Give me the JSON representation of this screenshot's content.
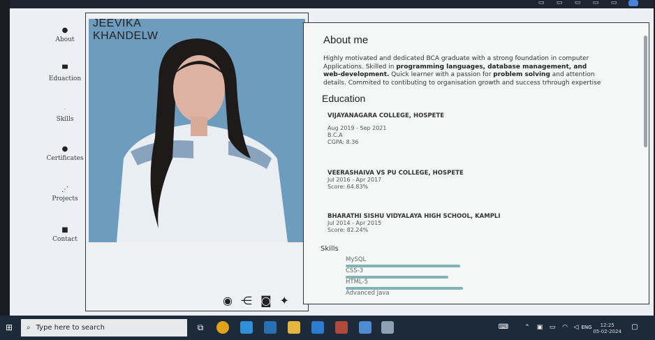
{
  "nav": {
    "items": [
      {
        "label": "About",
        "icon": "person-icon"
      },
      {
        "label": "Eduaction",
        "icon": "graduation-icon"
      },
      {
        "label": "Skills",
        "icon": "skills-icon"
      },
      {
        "label": "Certificates",
        "icon": "certificate-icon"
      },
      {
        "label": "Projects",
        "icon": "projects-icon"
      },
      {
        "label": "Contact",
        "icon": "contact-icon"
      }
    ]
  },
  "profile": {
    "name_line1": "JEEVIKA",
    "name_line2": "KHANDELW"
  },
  "about": {
    "title": "About me",
    "p1": "Highly motivated and dedicated BCA graduate with a strong foundation in computer Applications. Skilled in ",
    "b1": "programming languages, database management, and web-development.",
    "p2": " Quick learner with a passion for ",
    "b2": "problem solving",
    "p3": " and attention details. Commited to contibuting to organisation growth and success trhrough expertise"
  },
  "education": {
    "title": "Education",
    "entries": [
      {
        "school": "VIJAYANAGARA COLLEGE, HOSPETE",
        "dates": "Aug 2019 - Sep 2021",
        "degree": "B.C.A",
        "score": "CGPA: 8.36"
      },
      {
        "school": "VEERASHAIVA VS PU COLLEGE, HOSPETE",
        "dates": "Jul 2016 - Apr 2017",
        "degree": "",
        "score": "Score: 64.83%"
      },
      {
        "school": "BHARATHI SISHU VIDYALAYA HIGH SCHOOL, KAMPLI",
        "dates": "Jul 2014 - Apr 2015",
        "degree": "",
        "score": "Score: 82.24%"
      }
    ]
  },
  "skills": {
    "title": "Skills",
    "items": [
      {
        "name": "MySQL",
        "level": 0.78
      },
      {
        "name": "CSS-3",
        "level": 0.7
      },
      {
        "name": "HTML-5",
        "level": 0.8
      },
      {
        "name": "Advanced Java",
        "level": 0.6
      }
    ]
  },
  "taskbar": {
    "search_placeholder": "Type here to search",
    "time": "12:25",
    "date": "05-02-2024",
    "lang": "ENG"
  }
}
